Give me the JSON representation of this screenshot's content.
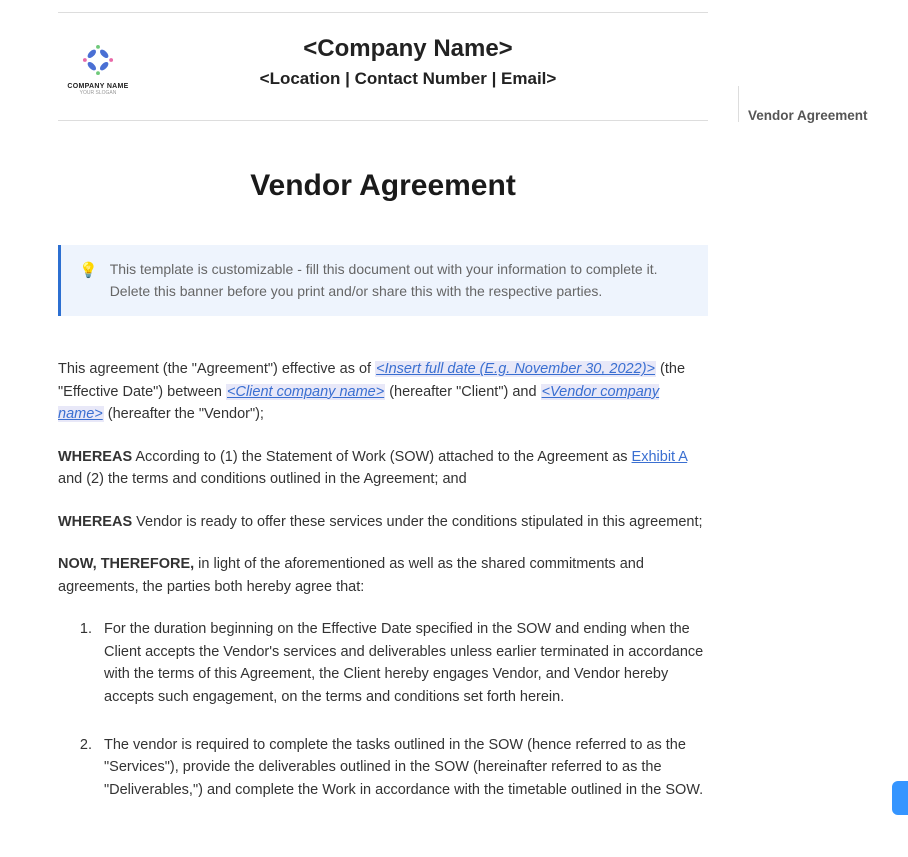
{
  "header": {
    "logo_text": "COMPANY NAME",
    "logo_subtext": "YOUR SLOGAN",
    "company_name_placeholder": "<Company Name>",
    "company_meta_placeholder": "<Location | Contact Number | Email>"
  },
  "toc": {
    "item1": "Vendor Agreement"
  },
  "doc": {
    "title": "Vendor Agreement"
  },
  "banner": {
    "text": "This template is customizable - fill this document out with your information to complete it. Delete this banner before you print and/or share this with the respective parties."
  },
  "intro": {
    "t1": "This agreement (the \"Agreement\") effective as of ",
    "ph_date": "<Insert full date (E.g. November 30, 2022)>",
    "t2": " (the \"Effective Date\") between ",
    "ph_client": "<Client company name>",
    "t3": " (hereafter \"Client\") and ",
    "ph_vendor": "<Vendor company name>",
    "t4": " (hereafter the \"Vendor\");"
  },
  "whereas1": {
    "label": "WHEREAS",
    "t1": " According to (1) the Statement of Work (SOW) attached to the Agreement as ",
    "link": "Exhibit A",
    "t2": " and (2) the terms and conditions outlined in the Agreement; and"
  },
  "whereas2": {
    "label": "WHEREAS",
    "t1": " Vendor is ready to offer these services under the conditions stipulated in this agreement;"
  },
  "therefore": {
    "label": "NOW, THEREFORE,",
    "t1": " in light of the aforementioned as well as the shared commitments and agreements, the parties both hereby agree that:"
  },
  "list": {
    "item1": "For the duration beginning on the Effective Date specified in the SOW and ending when the Client accepts the Vendor's services and deliverables unless earlier terminated in accordance with the terms of this Agreement, the Client hereby engages Vendor, and Vendor hereby accepts such engagement, on the terms and conditions set forth herein.",
    "item2": "The vendor is required to complete the tasks outlined in the SOW (hence referred to as the \"Services\"), provide the deliverables outlined in the SOW (hereinafter referred to as the \"Deliverables,\") and complete the Work in accordance with the timetable outlined in the SOW."
  }
}
